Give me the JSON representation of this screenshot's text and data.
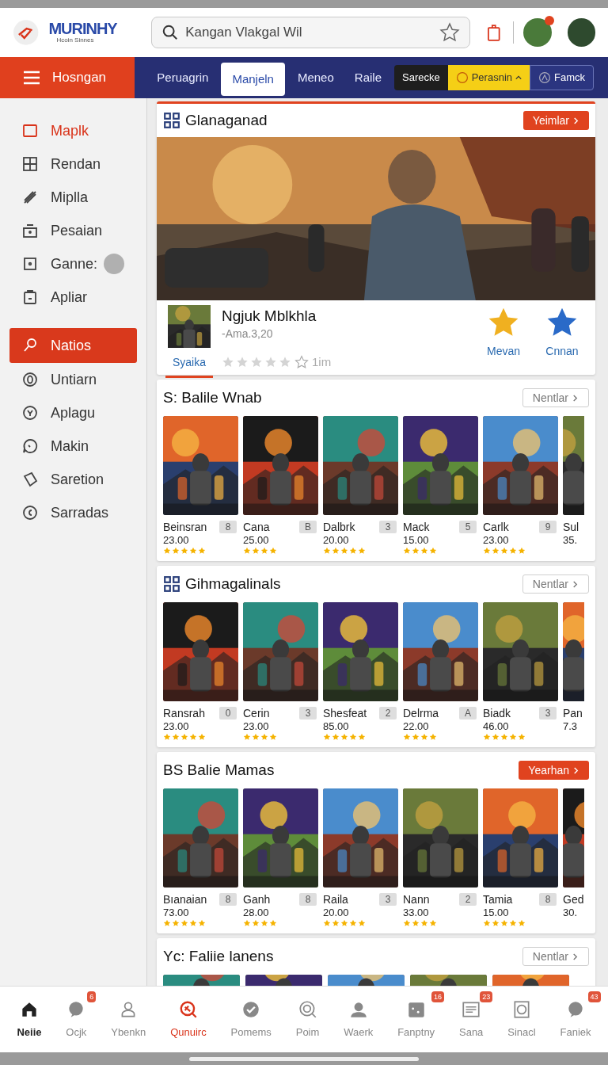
{
  "header": {
    "logo": "MURINHY",
    "logo_tagline": "Hcoin Sinnes",
    "search": {
      "value": "Kangan Vlakgal Wil"
    }
  },
  "nav": {
    "menu_label": "Hosngan",
    "tabs": [
      {
        "label": "Peruagrin",
        "selected": false
      },
      {
        "label": "Manjeln",
        "selected": true
      },
      {
        "label": "Meneo",
        "selected": false
      },
      {
        "label": "Raile",
        "selected": false
      }
    ],
    "actions": [
      {
        "label": "Sarecke",
        "kind": "dark"
      },
      {
        "label": "Perasnin",
        "kind": "yellow"
      },
      {
        "label": "Famck",
        "kind": "outline"
      }
    ]
  },
  "sidebar": {
    "items": [
      {
        "label": "Maplk",
        "selected": false,
        "accent": true,
        "dot": false
      },
      {
        "label": "Rendan",
        "selected": false,
        "accent": false,
        "dot": false
      },
      {
        "label": "Miplla",
        "selected": false,
        "accent": false,
        "dot": false
      },
      {
        "label": "Pesaian",
        "selected": false,
        "accent": false,
        "dot": false
      },
      {
        "label": "Ganne:",
        "selected": false,
        "accent": false,
        "dot": true
      },
      {
        "label": "Apliar",
        "selected": false,
        "accent": false,
        "dot": false
      },
      {
        "label": "Natios",
        "selected": true,
        "accent": false,
        "dot": false
      },
      {
        "label": "Untiarn",
        "selected": false,
        "accent": false,
        "dot": false
      },
      {
        "label": "Aplagu",
        "selected": false,
        "accent": false,
        "dot": false
      },
      {
        "label": "Makin",
        "selected": false,
        "accent": false,
        "dot": false
      },
      {
        "label": "Saretion",
        "selected": false,
        "accent": false,
        "dot": false
      },
      {
        "label": "Sarradas",
        "selected": false,
        "accent": false,
        "dot": false
      }
    ]
  },
  "featured": {
    "title": "Glanaganad",
    "button": {
      "label": "Yeimlar",
      "primary": true
    },
    "game": {
      "title": "Ngjuk Mblkhla",
      "subtitle": "-Ama.3,20",
      "link": "Syaika",
      "stars": 0,
      "rating_text": "1im"
    },
    "actions": [
      {
        "label": "Mevan",
        "kind": "gold"
      },
      {
        "label": "Cnnan",
        "kind": "blue"
      }
    ]
  },
  "sections": [
    {
      "title": "S: Balile Wnab",
      "grid_icon": false,
      "button": {
        "label": "Nentlar",
        "primary": false
      },
      "games": [
        {
          "name": "Beinsran",
          "badge": "8",
          "price": "23.00",
          "stars": 5
        },
        {
          "name": "Cana",
          "badge": "B",
          "price": "25.00",
          "stars": 4
        },
        {
          "name": "Dalbrk",
          "badge": "3",
          "price": "20.00",
          "stars": 5
        },
        {
          "name": "Mack",
          "badge": "5",
          "price": "15.00",
          "stars": 4
        },
        {
          "name": "Carlk",
          "badge": "9",
          "price": "23.00",
          "stars": 5
        },
        {
          "name": "Sul",
          "price": "35."
        }
      ]
    },
    {
      "title": "Gihmagalinals",
      "grid_icon": true,
      "button": {
        "label": "Nentlar",
        "primary": false
      },
      "games": [
        {
          "name": "Ransrah",
          "badge": "0",
          "price": "23.00",
          "stars": 5
        },
        {
          "name": "Cerin",
          "badge": "3",
          "price": "23.00",
          "stars": 4
        },
        {
          "name": "Shesfeat",
          "badge": "2",
          "price": "85.00",
          "stars": 5
        },
        {
          "name": "Delrma",
          "badge": "A",
          "price": "22.00",
          "stars": 4
        },
        {
          "name": "Biadk",
          "badge": "3",
          "price": "46.00",
          "stars": 5
        },
        {
          "name": "Pan",
          "price": "7.3"
        }
      ]
    },
    {
      "title": "BS Balie Mamas",
      "grid_icon": false,
      "button": {
        "label": "Yearhan",
        "primary": true
      },
      "games": [
        {
          "name": "Bıanaian",
          "badge": "8",
          "price": "73.00",
          "stars": 5
        },
        {
          "name": "Ganh",
          "badge": "8",
          "price": "28.00",
          "stars": 4
        },
        {
          "name": "Raila",
          "badge": "3",
          "price": "20.00",
          "stars": 5
        },
        {
          "name": "Nann",
          "badge": "2",
          "price": "33.00",
          "stars": 4
        },
        {
          "name": "Tamia",
          "badge": "8",
          "price": "15.00",
          "stars": 5
        },
        {
          "name": "Ged",
          "price": "30."
        }
      ]
    },
    {
      "title": "Yc: Faliie lanens",
      "grid_icon": false,
      "button": {
        "label": "Nentlar",
        "primary": false
      }
    }
  ],
  "bottom_nav": [
    {
      "label": "Neiie",
      "selected": false,
      "strong": true
    },
    {
      "label": "Ocjk",
      "selected": false,
      "strong": false,
      "badge": "6"
    },
    {
      "label": "Ybenkn",
      "selected": false,
      "strong": false
    },
    {
      "label": "Qunuirc",
      "selected": true,
      "strong": false
    },
    {
      "label": "Pomems",
      "selected": false,
      "strong": false
    },
    {
      "label": "Poim",
      "selected": false,
      "strong": false
    },
    {
      "label": "Waerk",
      "selected": false,
      "strong": false
    },
    {
      "label": "Fanptny",
      "selected": false,
      "strong": false,
      "badge": "16"
    },
    {
      "label": "Sana",
      "selected": false,
      "strong": false,
      "badge": "23"
    },
    {
      "label": "Sinacl",
      "selected": false,
      "strong": false
    },
    {
      "label": "Faniek",
      "selected": false,
      "strong": false,
      "badge": "43"
    }
  ]
}
